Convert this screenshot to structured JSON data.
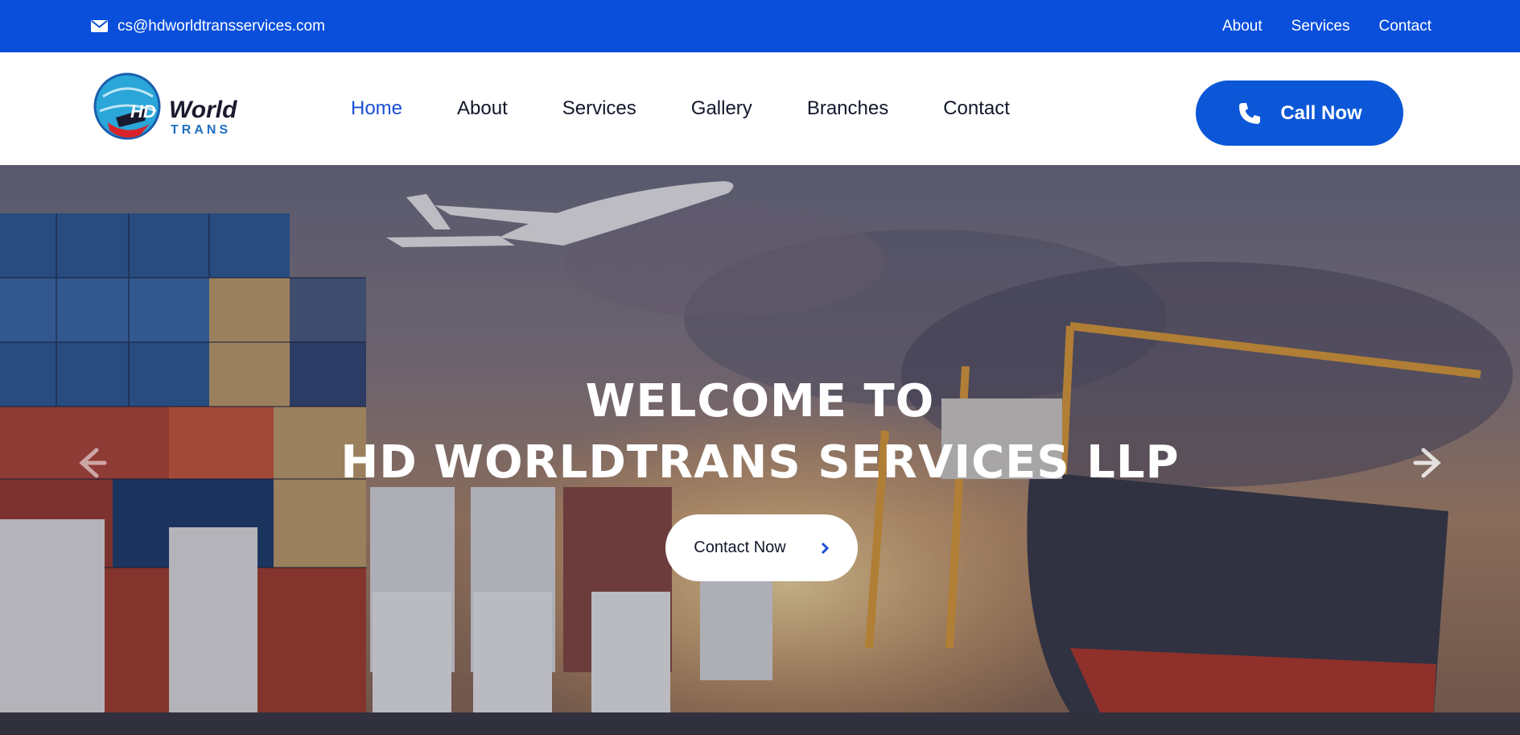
{
  "topbar": {
    "email": "cs@hdworldtransservices.com",
    "email_icon": "envelope-icon",
    "links": [
      "About",
      "Services",
      "Contact"
    ]
  },
  "header": {
    "logo_text": "World TRANS",
    "nav": [
      "Home",
      "About",
      "Services",
      "Gallery",
      "Branches",
      "Contact"
    ],
    "active_nav": "Home",
    "call_button": "Call Now",
    "call_icon": "phone-icon"
  },
  "hero": {
    "title_line1": "WELCOME TO",
    "title_line2": "HD WORLDTRANS SERVICES LLP",
    "cta": "Contact Now",
    "cta_icon": "chevron-right-icon",
    "prev_icon": "arrow-left-icon",
    "next_icon": "arrow-right-icon"
  },
  "colors": {
    "brand_blue": "#0a4fdc",
    "button_blue": "#0c57d7",
    "active_nav": "#1b4fd6",
    "text_dark": "#12182b"
  }
}
